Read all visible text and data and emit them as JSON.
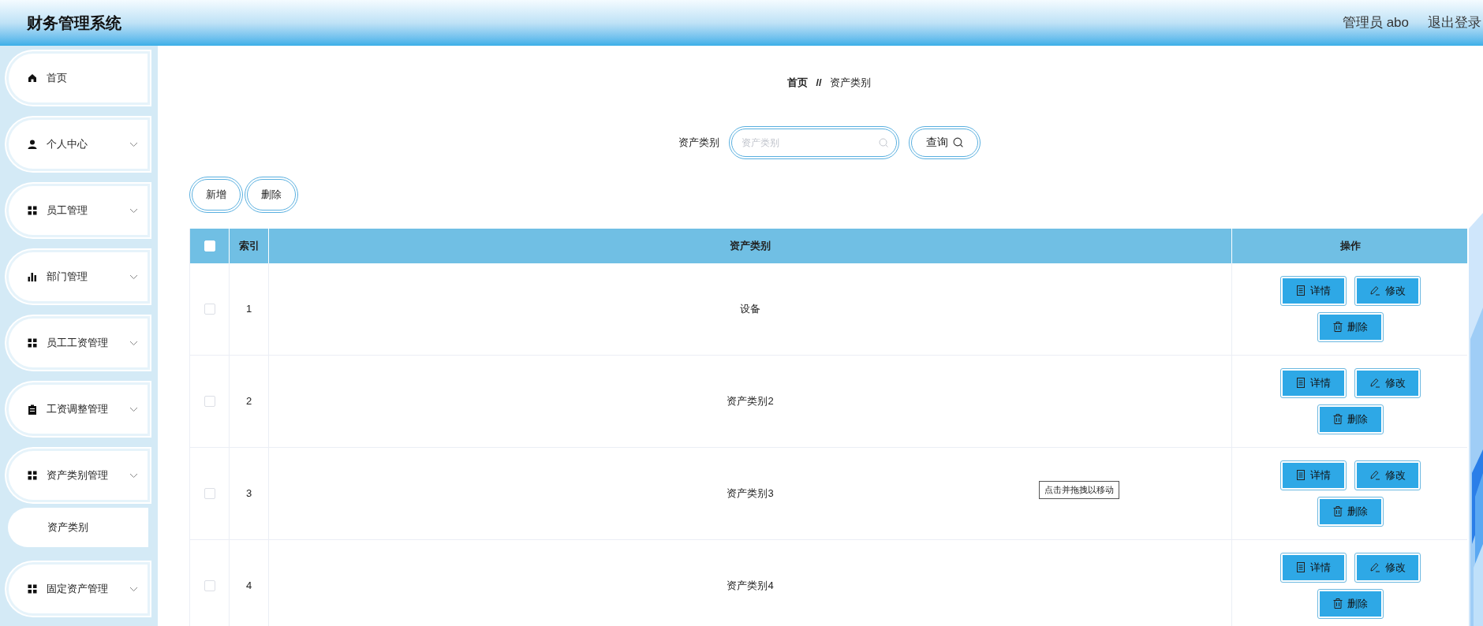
{
  "header": {
    "title": "财务管理系统",
    "user": "管理员 abo",
    "logout": "退出登录"
  },
  "sidebar": {
    "items": [
      {
        "kind": "home",
        "label": "首页",
        "has_submenu": false
      },
      {
        "kind": "user",
        "label": "个人中心",
        "has_submenu": true
      },
      {
        "kind": "grid",
        "label": "员工管理",
        "has_submenu": true
      },
      {
        "kind": "bars",
        "label": "部门管理",
        "has_submenu": true
      },
      {
        "kind": "grid",
        "label": "员工工资管理",
        "has_submenu": true
      },
      {
        "kind": "clipboard",
        "label": "工资调整管理",
        "has_submenu": true
      },
      {
        "kind": "grid",
        "label": "资产类别管理",
        "has_submenu": true,
        "children": [
          {
            "label": "资产类别",
            "selected": true
          }
        ]
      },
      {
        "kind": "grid",
        "label": "固定资产管理",
        "has_submenu": true
      }
    ]
  },
  "breadcrumb": [
    "首页",
    "//",
    "资产类别"
  ],
  "search": {
    "label": "资产类别",
    "placeholder": "资产类别",
    "button": "查询"
  },
  "toolbar": [
    "新增",
    "删除"
  ],
  "table": {
    "header_checked": false,
    "columns": [
      "索引",
      "资产类别",
      "操作"
    ],
    "rows": [
      {
        "checked": false,
        "index": "1",
        "category": "设备",
        "actions": [
          "详情",
          "修改",
          "删除"
        ]
      },
      {
        "checked": false,
        "index": "2",
        "category": "资产类别2",
        "actions": [
          "详情",
          "修改",
          "删除"
        ]
      },
      {
        "checked": false,
        "index": "3",
        "category": "资产类别3",
        "actions": [
          "详情",
          "修改",
          "删除"
        ]
      },
      {
        "checked": false,
        "index": "4",
        "category": "资产类别4",
        "actions": [
          "详情",
          "修改",
          "删除"
        ]
      }
    ]
  },
  "tooltip": "点击并拖拽以移动"
}
